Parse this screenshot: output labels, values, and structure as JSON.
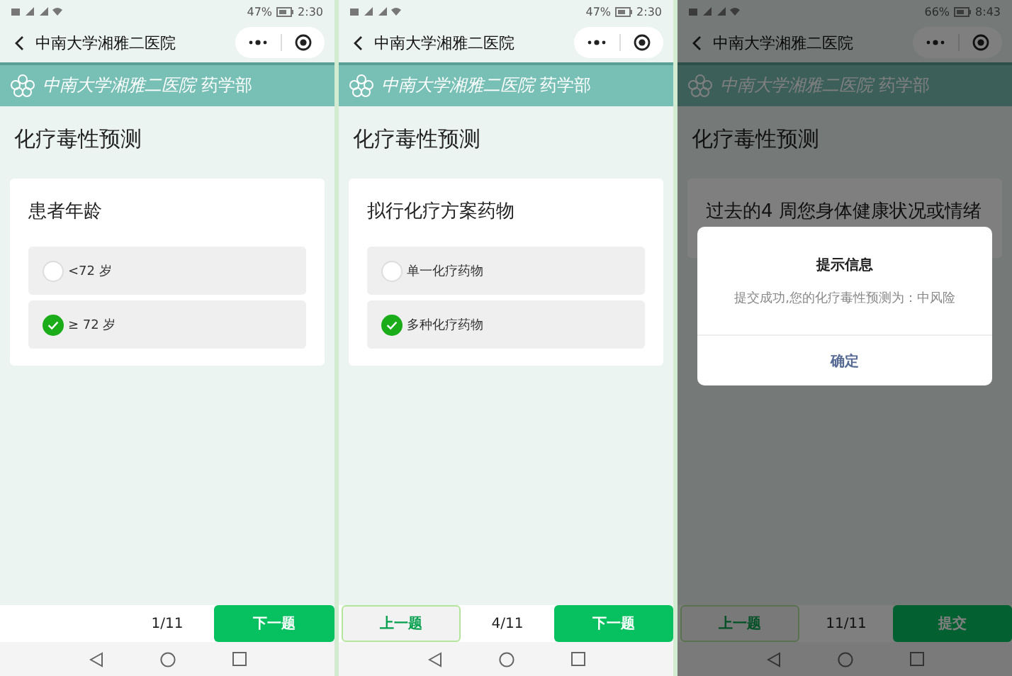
{
  "screens": [
    {
      "status_bar": {
        "battery": "47%",
        "time": "2:30"
      },
      "nav_title": "中南大学湘雅二医院",
      "banner": {
        "name": "中南大学湘雅二医院",
        "department": "药学部"
      },
      "page_title": "化疗毒性预测",
      "question": {
        "title": "患者年龄",
        "options": [
          {
            "label": "<72 岁",
            "selected": false
          },
          {
            "label": "≥ 72 岁",
            "selected": true
          }
        ]
      },
      "footer": {
        "counter": "1/11",
        "buttons": [
          {
            "kind": "next",
            "label": "下一题"
          }
        ]
      }
    },
    {
      "status_bar": {
        "battery": "47%",
        "time": "2:30"
      },
      "nav_title": "中南大学湘雅二医院",
      "banner": {
        "name": "中南大学湘雅二医院",
        "department": "药学部"
      },
      "page_title": "化疗毒性预测",
      "question": {
        "title": "拟行化疗方案药物",
        "options": [
          {
            "label": "单一化疗药物",
            "selected": false
          },
          {
            "label": "多种化疗药物",
            "selected": true
          }
        ]
      },
      "footer": {
        "counter": "4/11",
        "buttons": [
          {
            "kind": "prev",
            "label": "上一题"
          },
          {
            "kind": "next",
            "label": "下一题"
          }
        ]
      }
    },
    {
      "status_bar": {
        "battery": "66%",
        "time": "8:43"
      },
      "nav_title": "中南大学湘雅二医院",
      "banner": {
        "name": "中南大学湘雅二医院",
        "department": "药学部"
      },
      "page_title": "化疗毒性预测",
      "question": {
        "title": "过去的4 周您身体健康状况或情绪"
      },
      "footer": {
        "counter": "11/11",
        "buttons": [
          {
            "kind": "prev",
            "label": "上一题"
          },
          {
            "kind": "submit",
            "label": "提交"
          }
        ]
      },
      "dialog": {
        "title": "提示信息",
        "message": "提交成功,您的化疗毒性预测为：中风险",
        "button": "确定"
      }
    }
  ]
}
